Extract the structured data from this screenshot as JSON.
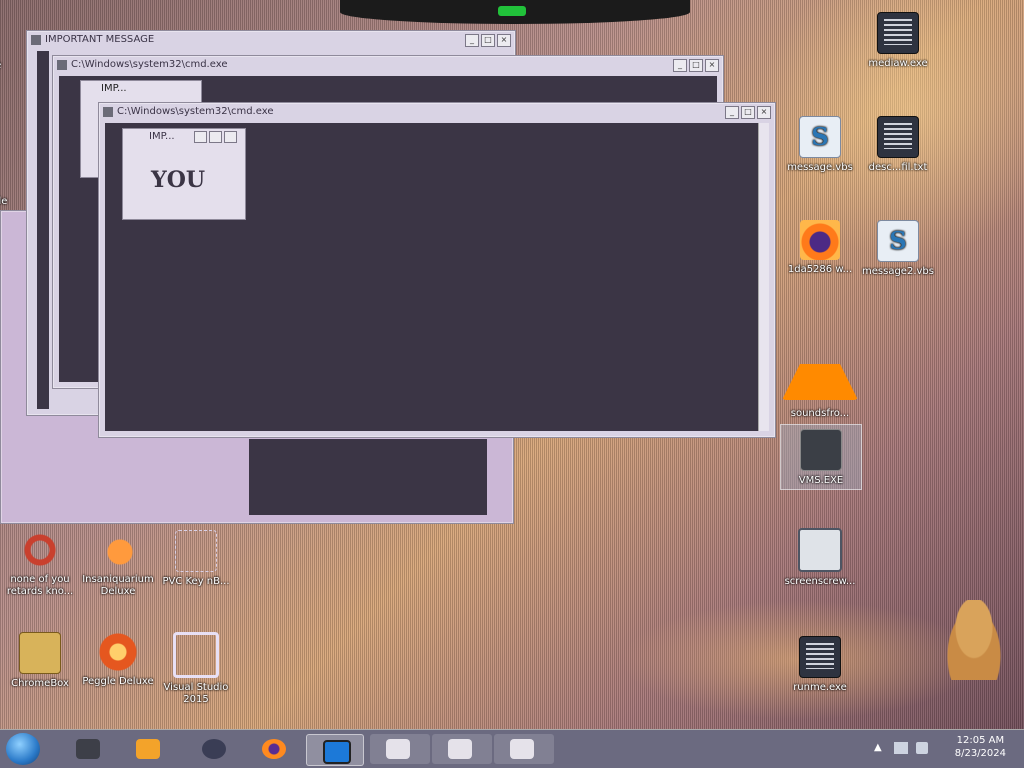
{
  "desktop": {
    "icons_left": [
      {
        "label": "none of you retards kno...",
        "icon": "swirl-icon"
      },
      {
        "label": "Insaniquarium Deluxe",
        "icon": "fish-icon"
      },
      {
        "label": "PVC Key nB...",
        "icon": "blank-icon"
      },
      {
        "label": "ChromeBox",
        "icon": "chrome-icon"
      },
      {
        "label": "Peggle Deluxe",
        "icon": "peggle-icon"
      },
      {
        "label": "Visual Studio 2015",
        "icon": "visual-studio-icon"
      }
    ],
    "icons_right": [
      {
        "label": "mediaw.exe",
        "icon": "document-icon"
      },
      {
        "label": "message.vbs",
        "icon": "vbs-icon"
      },
      {
        "label": "desc...fil.txt",
        "icon": "document-icon"
      },
      {
        "label": "1da5286 w...",
        "icon": "firefox-icon"
      },
      {
        "label": "message2.vbs",
        "icon": "vbs-icon"
      },
      {
        "label": "soundsfro...",
        "icon": "vlc-icon"
      },
      {
        "label": "VMS.EXE",
        "icon": "exe-icon"
      },
      {
        "label": "screenscrew...",
        "icon": "screen-icon"
      },
      {
        "label": "runme.exe",
        "icon": "document-icon"
      }
    ],
    "partial_labels": [
      "Re",
      "nde"
    ]
  },
  "windows": {
    "important": {
      "title": "IMPORTANT MESSAGE"
    },
    "cmd1": {
      "title": "C:\\Windows\\system32\\cmd.exe"
    },
    "cmd2": {
      "title": "C:\\Windows\\system32\\cmd.exe"
    },
    "imp1": {
      "title": "IMP..."
    },
    "imp2": {
      "title": "IMP..."
    },
    "you_text": "YOU"
  },
  "taskbar": {
    "pinned": [
      "app-icon",
      "media-player-icon",
      "globe-icon",
      "firefox-icon",
      "screen-icon",
      "window-icon",
      "window-icon",
      "window-icon"
    ],
    "time": "12:05 AM",
    "date": "8/23/2024"
  }
}
